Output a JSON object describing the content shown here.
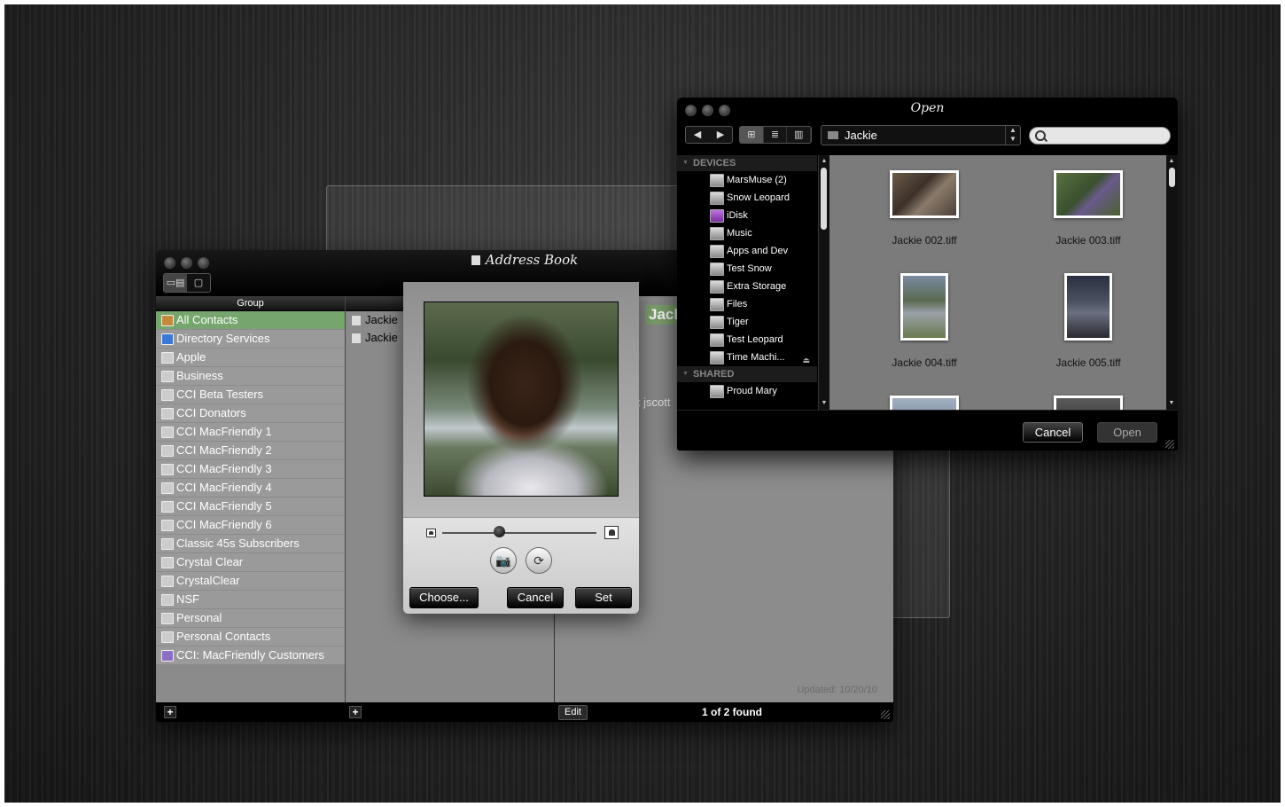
{
  "address_book": {
    "title": "Address Book",
    "view_icons": [
      "▭▤",
      "▢"
    ],
    "group_header": "Group",
    "groups": [
      {
        "label": "All Contacts",
        "icon": "all-contacts-icon",
        "selected": true
      },
      {
        "label": "Directory Services",
        "icon": "directory-icon"
      },
      {
        "label": "Apple",
        "icon": "group-icon"
      },
      {
        "label": "Business",
        "icon": "group-icon"
      },
      {
        "label": "CCI Beta Testers",
        "icon": "group-icon"
      },
      {
        "label": "CCI Donators",
        "icon": "group-icon"
      },
      {
        "label": "CCI MacFriendly 1",
        "icon": "group-icon"
      },
      {
        "label": "CCI MacFriendly 2",
        "icon": "group-icon"
      },
      {
        "label": "CCI MacFriendly 3",
        "icon": "group-icon"
      },
      {
        "label": "CCI MacFriendly 4",
        "icon": "group-icon"
      },
      {
        "label": "CCI MacFriendly 5",
        "icon": "group-icon"
      },
      {
        "label": "CCI MacFriendly 6",
        "icon": "group-icon"
      },
      {
        "label": "Classic 45s Subscribers",
        "icon": "group-icon"
      },
      {
        "label": "Crystal Clear",
        "icon": "group-icon"
      },
      {
        "label": "CrystalClear",
        "icon": "group-icon"
      },
      {
        "label": "NSF",
        "icon": "group-icon"
      },
      {
        "label": "Personal",
        "icon": "group-icon"
      },
      {
        "label": "Personal Contacts",
        "icon": "group-icon"
      },
      {
        "label": "CCI: MacFriendly Customers",
        "icon": "smart-group-icon"
      }
    ],
    "names": [
      "Jackie",
      "Jackie"
    ],
    "card": {
      "name": "Jackie S",
      "email_fragment": "x jscott"
    },
    "updated": "Updated: 10/20/10",
    "footer": {
      "add": "+",
      "edit": "Edit",
      "found": "1 of 2 found"
    }
  },
  "picture_editor": {
    "slider_level": 0.37,
    "camera_icon": "📷",
    "effects_icon": "⟳",
    "buttons": {
      "choose": "Choose...",
      "cancel": "Cancel",
      "set": "Set"
    }
  },
  "open_dialog": {
    "title": "Open",
    "nav": {
      "back": "◀",
      "forward": "▶"
    },
    "views": [
      "⊞",
      "≣",
      "▥"
    ],
    "location": "Jackie",
    "search_placeholder": "",
    "sections": [
      {
        "label": "DEVICES",
        "items": [
          {
            "label": "MarsMuse (2)",
            "icon": "computer-icon"
          },
          {
            "label": "Snow Leopard",
            "icon": "drive-icon"
          },
          {
            "label": "iDisk",
            "icon": "idisk-icon"
          },
          {
            "label": "Music",
            "icon": "drive-icon"
          },
          {
            "label": "Apps and Dev",
            "icon": "drive-icon"
          },
          {
            "label": "Test Snow",
            "icon": "drive-icon"
          },
          {
            "label": "Extra Storage",
            "icon": "drive-icon"
          },
          {
            "label": "Files",
            "icon": "drive-icon"
          },
          {
            "label": "Tiger",
            "icon": "drive-icon"
          },
          {
            "label": "Test Leopard",
            "icon": "drive-icon"
          },
          {
            "label": "Time Machi...",
            "icon": "time-machine-icon",
            "eject": "⏏"
          }
        ]
      },
      {
        "label": "SHARED",
        "items": [
          {
            "label": "Proud Mary",
            "icon": "network-computer-icon"
          }
        ]
      }
    ],
    "files": [
      {
        "label": "Jackie  002.tiff"
      },
      {
        "label": "Jackie  003.tiff"
      },
      {
        "label": "Jackie  004.tiff"
      },
      {
        "label": "Jackie  005.tiff"
      }
    ],
    "buttons": {
      "cancel": "Cancel",
      "open": "Open"
    }
  }
}
